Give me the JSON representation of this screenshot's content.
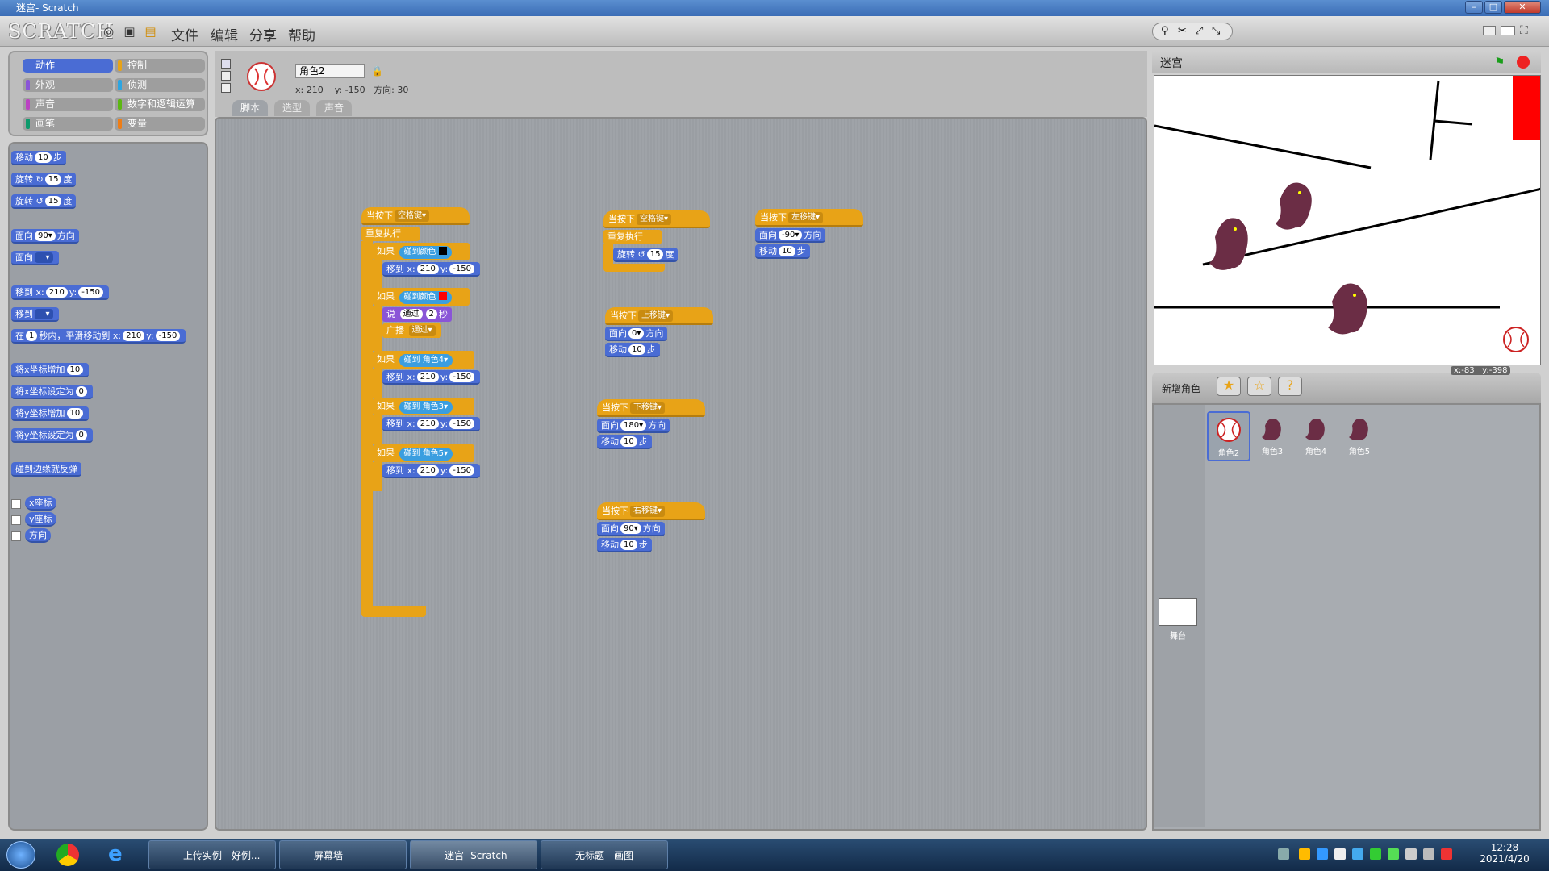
{
  "window": {
    "title": "迷宫- Scratch"
  },
  "menubar": {
    "logo": "SCRATCH",
    "menus": [
      "文件",
      "编辑",
      "分享",
      "帮助"
    ]
  },
  "categories": [
    {
      "label": "动作",
      "color": "#4a6cd4",
      "selected": true
    },
    {
      "label": "控制",
      "color": "#e8a317"
    },
    {
      "label": "外观",
      "color": "#8a55d7"
    },
    {
      "label": "侦测",
      "color": "#2ca5e2"
    },
    {
      "label": "声音",
      "color": "#bb42c3"
    },
    {
      "label": "数字和逻辑运算",
      "color": "#5cb712"
    },
    {
      "label": "画笔",
      "color": "#0e9a6c"
    },
    {
      "label": "变量",
      "color": "#ee7d16"
    }
  ],
  "palette": {
    "move": {
      "a": "移动",
      "v": "10",
      "b": "步"
    },
    "turn_right": {
      "a": "旋转",
      "icon": "↻",
      "v": "15",
      "b": "度"
    },
    "turn_left": {
      "a": "旋转",
      "icon": "↺",
      "v": "15",
      "b": "度"
    },
    "point_dir": {
      "a": "面向",
      "v": "90",
      "b": "方向"
    },
    "point_to": {
      "a": "面向"
    },
    "goto_xy": {
      "a": "移到",
      "x": "x:",
      "xv": "210",
      "y": "y:",
      "yv": "-150"
    },
    "goto": {
      "a": "移到"
    },
    "glide": {
      "a": "在",
      "v": "1",
      "b": "秒内，平滑移动到",
      "x": "x:",
      "xv": "210",
      "y": "y:",
      "yv": "-150"
    },
    "change_x": {
      "a": "将x坐标增加",
      "v": "10"
    },
    "set_x": {
      "a": "将x坐标设定为",
      "v": "0"
    },
    "change_y": {
      "a": "将y坐标增加",
      "v": "10"
    },
    "set_y": {
      "a": "将y坐标设定为",
      "v": "0"
    },
    "bounce": "碰到边缘就反弹",
    "xpos": "x座标",
    "ypos": "y座标",
    "direction": "方向"
  },
  "sprite": {
    "name": "角色2",
    "x_label": "x:",
    "x": "210",
    "y_label": "y:",
    "y": "-150",
    "dir_label": "方向:",
    "dir": "30"
  },
  "tabs": [
    "脚本",
    "造型",
    "声音"
  ],
  "script_main": {
    "hat": "当按下",
    "key": "空格键",
    "forever": "重复执行",
    "if": "如果",
    "touch_color": "碰到颜色",
    "touch": "碰到",
    "goto": "移到",
    "x": "x:",
    "xv": "210",
    "y": "y:",
    "yv": "-150",
    "say": "说",
    "say_text": "通过",
    "say_secs": "2",
    "secs": "秒",
    "broadcast": "广播",
    "broadcast_msg": "通过",
    "sprite4": "角色4",
    "sprite3": "角色3",
    "sprite5": "角色5",
    "black": "#000000",
    "red": "#ff0000"
  },
  "script_spin": {
    "hat": "当按下",
    "key": "空格键",
    "forever": "重复执行",
    "turn": "旋转",
    "icon": "↺",
    "v": "15",
    "b": "度"
  },
  "script_left": {
    "hat": "当按下",
    "key": "左移键",
    "point": "面向",
    "dir": "-90",
    "dir_b": "方向",
    "move": "移动",
    "v": "10",
    "b": "步"
  },
  "script_up": {
    "hat": "当按下",
    "key": "上移键",
    "point": "面向",
    "dir": "0",
    "dir_b": "方向",
    "move": "移动",
    "v": "10",
    "b": "步"
  },
  "script_down": {
    "hat": "当按下",
    "key": "下移键",
    "point": "面向",
    "dir": "180",
    "dir_b": "方向",
    "move": "移动",
    "v": "10",
    "b": "步"
  },
  "script_right": {
    "hat": "当按下",
    "key": "右移键",
    "point": "面向",
    "dir": "90",
    "dir_b": "方向",
    "move": "移动",
    "v": "10",
    "b": "步"
  },
  "stage": {
    "title": "迷宫",
    "mouse_x_label": "x:",
    "mouse_x": "-83",
    "mouse_y_label": "y:",
    "mouse_y": "-398"
  },
  "sprites_panel": {
    "new_sprite": "新增角色",
    "sprites": [
      "角色2",
      "角色3",
      "角色4",
      "角色5"
    ],
    "stage_label": "舞台"
  },
  "taskbar": {
    "tasks": [
      "上传实例 - 好例...",
      "屏幕墙",
      "迷宫- Scratch",
      "无标题 - 画图"
    ],
    "time": "12:28",
    "date": "2021/4/20"
  }
}
